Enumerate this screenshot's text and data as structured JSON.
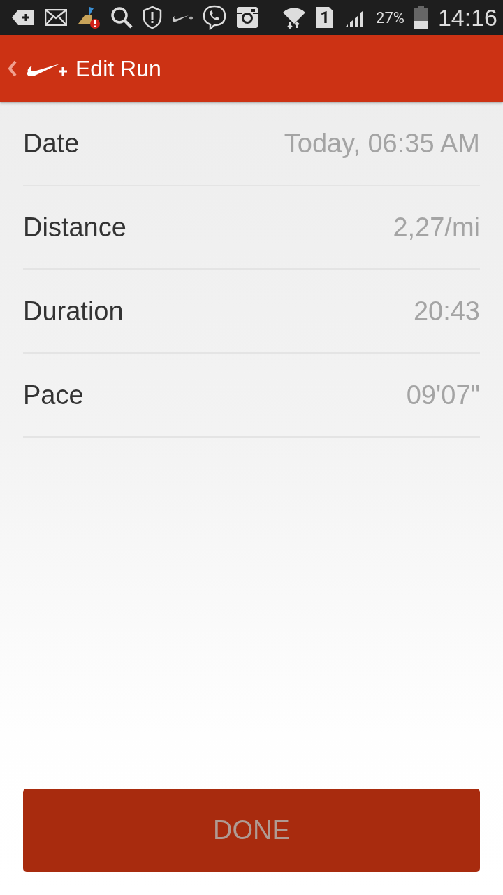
{
  "status_bar": {
    "sim_slot": "1",
    "battery": "27%",
    "time": "14:16"
  },
  "header": {
    "title": "Edit Run"
  },
  "fields": [
    {
      "label": "Date",
      "value": "Today, 06:35 AM"
    },
    {
      "label": "Distance",
      "value": "2,27/mi"
    },
    {
      "label": "Duration",
      "value": "20:43"
    },
    {
      "label": "Pace",
      "value": "09'07\""
    }
  ],
  "done_button": {
    "label": "DONE",
    "disabled": true
  }
}
